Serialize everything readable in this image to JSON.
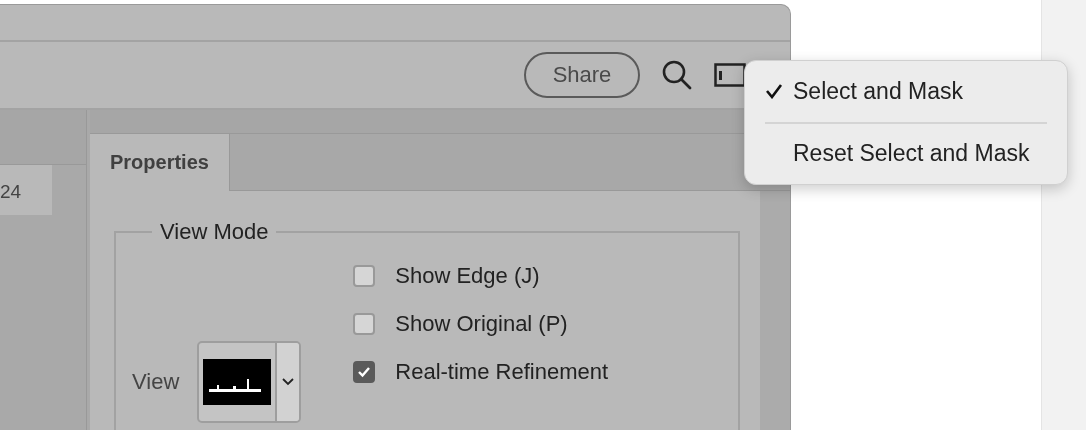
{
  "toolbar": {
    "share_button": "Share"
  },
  "ruler": {
    "label": "24"
  },
  "properties_panel": {
    "tabs": [
      {
        "label": "Properties",
        "selected": true
      }
    ],
    "view_mode": {
      "title": "View Mode",
      "view_label": "View",
      "options": [
        {
          "label": "Show Edge (J)",
          "checked": false
        },
        {
          "label": "Show Original (P)",
          "checked": false
        },
        {
          "label": "Real-time Refinement",
          "checked": true
        }
      ]
    }
  },
  "menu": {
    "items": [
      {
        "label": "Select and Mask",
        "selected": true
      },
      {
        "label": "Reset Select and Mask",
        "selected": false
      }
    ]
  }
}
